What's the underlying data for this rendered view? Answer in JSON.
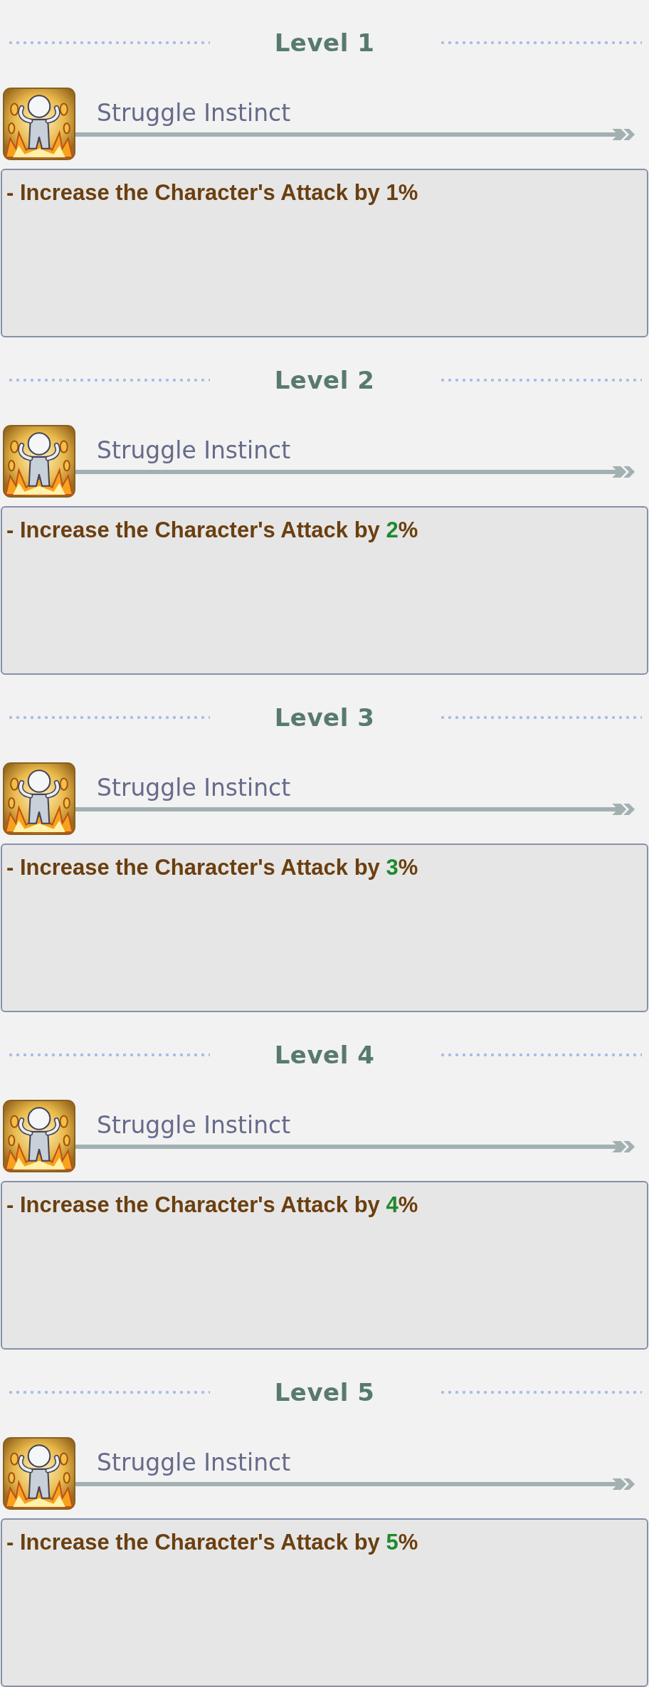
{
  "levels": [
    {
      "heading": "Level 1",
      "skill": "Struggle Instinct",
      "description": {
        "prefix": "- Increase the Character's Attack by ",
        "value": "1",
        "suffix": "%",
        "highlighted": false
      }
    },
    {
      "heading": "Level 2",
      "skill": "Struggle Instinct",
      "description": {
        "prefix": "- Increase the Character's Attack by ",
        "value": "2",
        "suffix": "%",
        "highlighted": true
      }
    },
    {
      "heading": "Level 3",
      "skill": "Struggle Instinct",
      "description": {
        "prefix": "- Increase the Character's Attack by ",
        "value": "3",
        "suffix": "%",
        "highlighted": true
      }
    },
    {
      "heading": "Level 4",
      "skill": "Struggle Instinct",
      "description": {
        "prefix": "- Increase the Character's Attack by ",
        "value": "4",
        "suffix": "%",
        "highlighted": true
      }
    },
    {
      "heading": "Level 5",
      "skill": "Struggle Instinct",
      "description": {
        "prefix": "- Increase the Character's Attack by ",
        "value": "5",
        "suffix": "%",
        "highlighted": true
      }
    }
  ]
}
